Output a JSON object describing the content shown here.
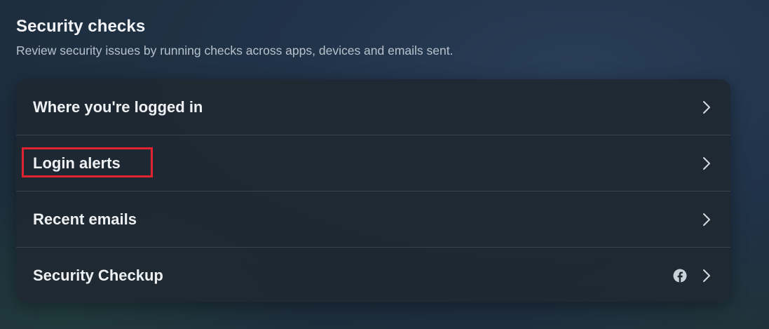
{
  "section": {
    "title": "Security checks",
    "subtitle": "Review security issues by running checks across apps, devices and emails sent."
  },
  "items": [
    {
      "label": "Where you're logged in",
      "icon": "chevron-right-icon"
    },
    {
      "label": "Login alerts",
      "icon": "chevron-right-icon",
      "highlighted": true
    },
    {
      "label": "Recent emails",
      "icon": "chevron-right-icon"
    },
    {
      "label": "Security Checkup",
      "icon": "chevron-right-icon",
      "badge_icon": "facebook-icon"
    }
  ],
  "colors": {
    "highlight": "#e0232e",
    "card_background": "#1e2831",
    "text_primary": "#eef1f4",
    "text_secondary": "#b8c2cd"
  }
}
